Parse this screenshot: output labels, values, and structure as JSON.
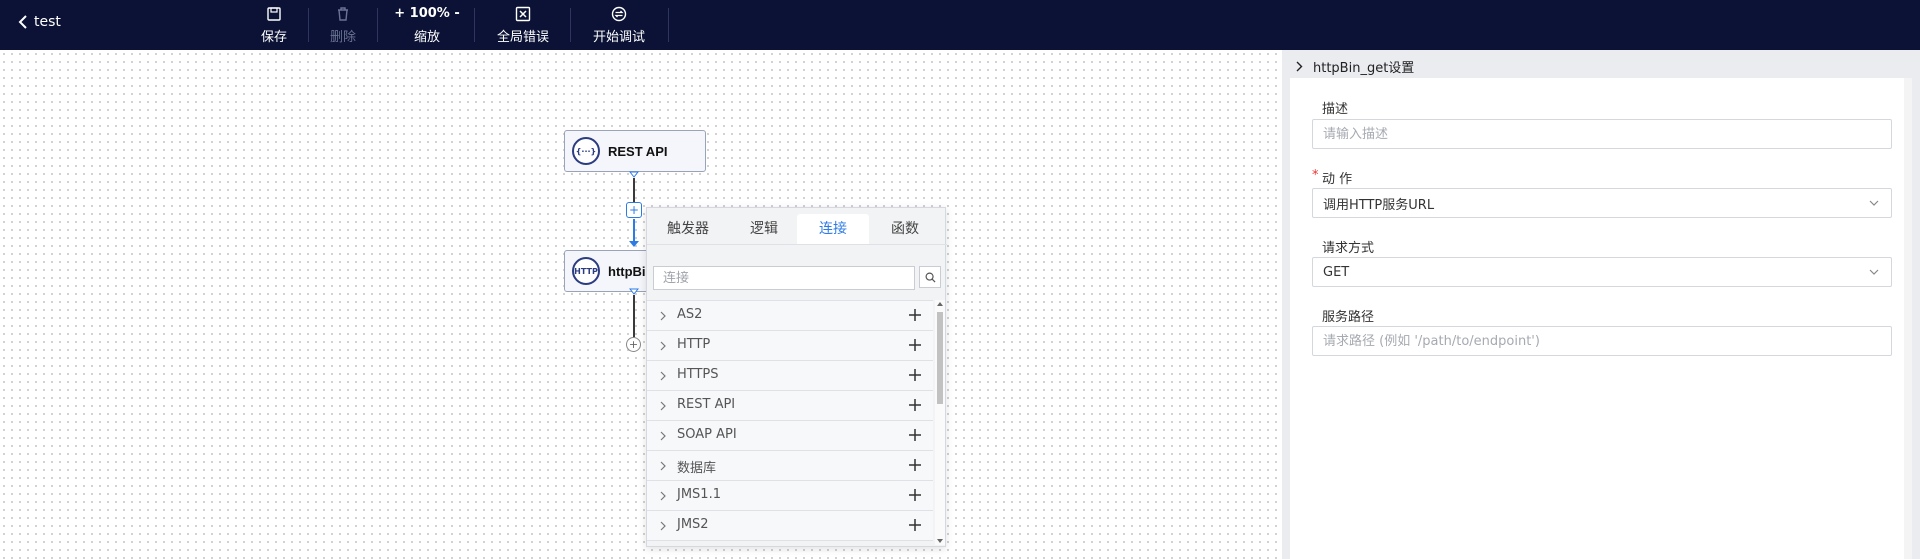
{
  "topbar": {
    "back_label": "test",
    "save_label": "保存",
    "delete_label": "删除",
    "zoom_value": "+ 100% -",
    "zoom_label": "缩放",
    "global_error_label": "全局错误",
    "debug_label": "开始调试"
  },
  "canvas": {
    "nodes": [
      {
        "label": "REST API",
        "icon": "rest-api-icon",
        "icon_text": "{···}"
      },
      {
        "label": "httpBi",
        "icon": "http-icon",
        "icon_text": "HTTP"
      }
    ]
  },
  "popup": {
    "tabs": [
      "触发器",
      "逻辑",
      "连接",
      "函数"
    ],
    "active_tab": "连接",
    "search_placeholder": "连接",
    "items": [
      "AS2",
      "HTTP",
      "HTTPS",
      "REST API",
      "SOAP API",
      "数据库",
      "JMS1.1",
      "JMS2"
    ]
  },
  "right_panel": {
    "title": "httpBin_get设置",
    "description_label": "描述",
    "description_placeholder": "请输入描述",
    "action_label": "动 作",
    "action_required_mark": "*",
    "action_value": "调用HTTP服务URL",
    "method_label": "请求方式",
    "method_value": "GET",
    "path_label": "服务路径",
    "path_placeholder": "请求路径 (例如 '/path/to/endpoint')"
  },
  "colors": {
    "topbar_bg": "#0b1235",
    "accent": "#2d7be5",
    "panel_bg": "#eaecf0"
  }
}
